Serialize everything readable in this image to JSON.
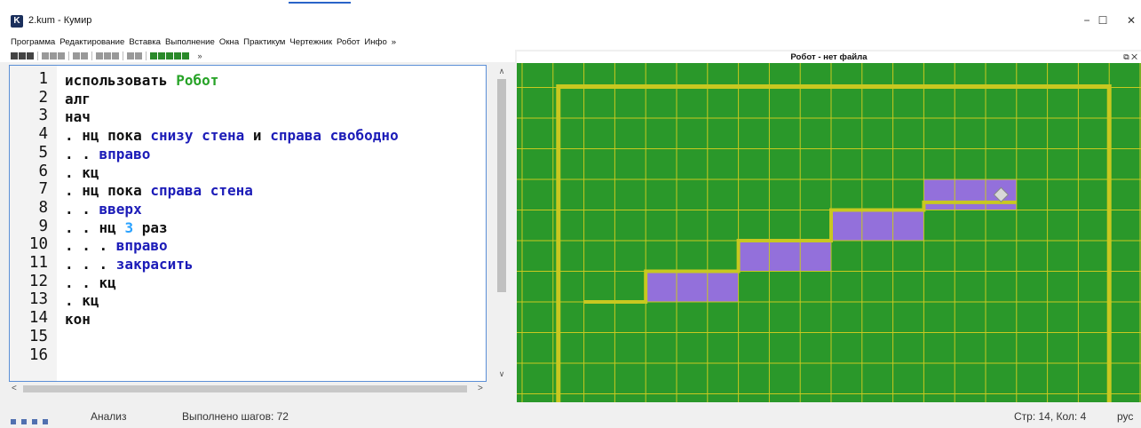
{
  "window": {
    "title": "2.kum - Кумир",
    "app_icon_letter": "K",
    "minimize_glyph": "−",
    "maximize_glyph": "☐",
    "close_glyph": "✕"
  },
  "menu": [
    "Программа",
    "Редактирование",
    "Вставка",
    "Выполнение",
    "Окна",
    "Практикум",
    "Чертежник",
    "Робот",
    "Инфо",
    "»"
  ],
  "toolbar": {
    "more": "»"
  },
  "editor": {
    "line_numbers": [
      "1",
      "2",
      "3",
      "4",
      "5",
      "6",
      "7",
      "8",
      "9",
      "10",
      "11",
      "12",
      "13",
      "14",
      "15",
      "16"
    ],
    "lines": [
      [
        {
          "t": "использовать ",
          "c": "k"
        },
        {
          "t": "Робот",
          "c": "g"
        }
      ],
      [
        {
          "t": "алг",
          "c": "k"
        }
      ],
      [
        {
          "t": "нач",
          "c": "k"
        }
      ],
      [
        {
          "t": ". нц пока ",
          "c": "k"
        },
        {
          "t": "снизу стена",
          "c": "b"
        },
        {
          "t": " и ",
          "c": "k"
        },
        {
          "t": "справа свободно",
          "c": "b"
        }
      ],
      [
        {
          "t": ". . ",
          "c": "k"
        },
        {
          "t": "вправо",
          "c": "b"
        }
      ],
      [
        {
          "t": ". кц",
          "c": "k"
        }
      ],
      [
        {
          "t": ". нц пока ",
          "c": "k"
        },
        {
          "t": "справа стена",
          "c": "b"
        }
      ],
      [
        {
          "t": ". . ",
          "c": "k"
        },
        {
          "t": "вверх",
          "c": "b"
        }
      ],
      [
        {
          "t": ". . нц ",
          "c": "k"
        },
        {
          "t": "3",
          "c": "n"
        },
        {
          "t": " раз",
          "c": "k"
        }
      ],
      [
        {
          "t": ". . . ",
          "c": "k"
        },
        {
          "t": "вправо",
          "c": "b"
        }
      ],
      [
        {
          "t": ". . . ",
          "c": "k"
        },
        {
          "t": "закрасить",
          "c": "b"
        }
      ],
      [
        {
          "t": ". . кц",
          "c": "k"
        }
      ],
      [
        {
          "t": ". кц",
          "c": "k"
        }
      ],
      [
        {
          "t": "кон",
          "c": "k"
        }
      ],
      [],
      []
    ]
  },
  "robot_panel": {
    "title": "Робот - нет файла",
    "controls": "⧉ ✕",
    "colors": {
      "field": "#2a982a",
      "grid": "#c8c820",
      "wall": "#c8c820",
      "painted": "#9370db",
      "robot": "#d8d8d8"
    },
    "painted_cells": [
      [
        4,
        7
      ],
      [
        5,
        7
      ],
      [
        6,
        7
      ],
      [
        7,
        6
      ],
      [
        8,
        6
      ],
      [
        9,
        6
      ],
      [
        10,
        5
      ],
      [
        11,
        5
      ],
      [
        12,
        5
      ],
      [
        13,
        4
      ],
      [
        14,
        4
      ],
      [
        15,
        4
      ]
    ],
    "robot_cell": [
      15,
      4
    ]
  },
  "status": {
    "mode": "Анализ",
    "steps": "Выполнено шагов: 72",
    "cursor": "Стр: 14, Кол: 4",
    "lang": "рус"
  }
}
